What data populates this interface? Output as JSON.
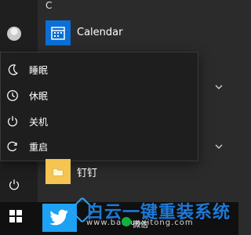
{
  "start": {
    "section_letter": "C",
    "apps": [
      {
        "label": "Calendar"
      },
      {
        "label": "钉钉"
      }
    ]
  },
  "power_menu": {
    "items": [
      {
        "label": "睡眠",
        "icon": "moon-icon"
      },
      {
        "label": "休眠",
        "icon": "clock-icon"
      },
      {
        "label": "关机",
        "icon": "power-icon"
      },
      {
        "label": "重启",
        "icon": "restart-icon"
      }
    ]
  },
  "taskbar": {
    "watermark_title": "白云一键重装系统",
    "watermark_url": "www.baiyunxitong.com",
    "wechat_label": "微信"
  },
  "colors": {
    "calendar_tile": "#0a6fd6",
    "folder_tile": "#f5c451",
    "bird_tile": "#1da1f2",
    "watermark": "#1e79d8"
  }
}
